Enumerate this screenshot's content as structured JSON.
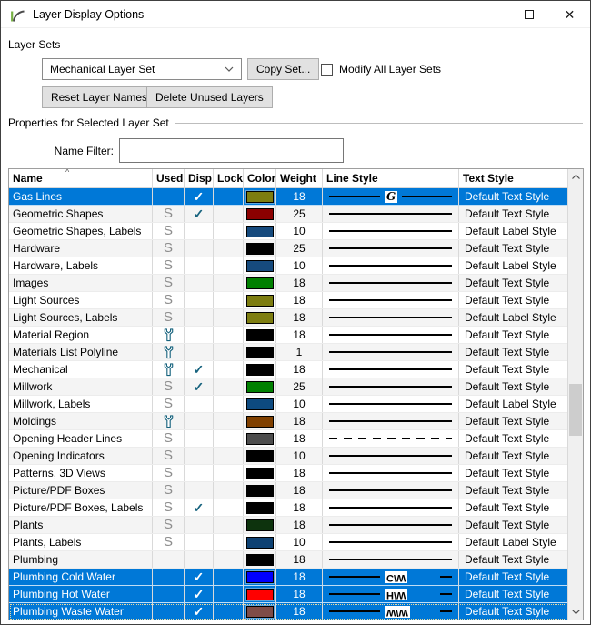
{
  "window": {
    "title": "Layer Display Options"
  },
  "icons": {
    "app_icon": "chief-architect-logo",
    "minimize": "minimize-dash",
    "maximize": "maximize-square",
    "close": "✕",
    "dropdown_chevron": "chevron-down",
    "check": "✓",
    "sort_ascending": "^",
    "used_in_plan": "S",
    "used_wrench": "wrench"
  },
  "layer_sets": {
    "group_label": "Layer Sets",
    "selected_set": "Mechanical Layer Set",
    "copy_button": "Copy Set...",
    "modify_all_label": "Modify All Layer Sets",
    "modify_all_checked": false,
    "reset_button": "Reset Layer Names",
    "delete_button": "Delete Unused Layers"
  },
  "properties": {
    "group_label": "Properties for Selected Layer Set",
    "name_filter_label": "Name Filter:",
    "name_filter_value": ""
  },
  "colors": {
    "selection": "#0078d7",
    "check_mark": "#17637e",
    "wrench_icon": "#17637e",
    "used_marker": "#8d8d8d",
    "row_stripe": "#f4f4f4"
  },
  "table": {
    "columns": [
      "Name",
      "Used",
      "Disp",
      "Lock",
      "Color",
      "Weight",
      "Line Style",
      "Text Style"
    ],
    "rows": [
      {
        "name": "Gas Lines",
        "used": "",
        "disp": true,
        "lock": false,
        "color": "#7d7d10",
        "weight": "18",
        "line": {
          "style": "label-mid",
          "label": "G"
        },
        "text_style": "Default Text Style",
        "selected": true,
        "focused": false
      },
      {
        "name": "Geometric Shapes",
        "used": "s",
        "disp": true,
        "lock": false,
        "color": "#8b0000",
        "weight": "25",
        "line": {
          "style": "solid",
          "label": ""
        },
        "text_style": "Default Text Style",
        "selected": false,
        "focused": false
      },
      {
        "name": "Geometric Shapes, Labels",
        "used": "s",
        "disp": false,
        "lock": false,
        "color": "#164a7d",
        "weight": "10",
        "line": {
          "style": "solid",
          "label": ""
        },
        "text_style": "Default Label Style",
        "selected": false,
        "focused": false
      },
      {
        "name": "Hardware",
        "used": "s",
        "disp": false,
        "lock": false,
        "color": "#000000",
        "weight": "25",
        "line": {
          "style": "solid",
          "label": ""
        },
        "text_style": "Default Text Style",
        "selected": false,
        "focused": false
      },
      {
        "name": "Hardware, Labels",
        "used": "s",
        "disp": false,
        "lock": false,
        "color": "#164a7d",
        "weight": "10",
        "line": {
          "style": "solid",
          "label": ""
        },
        "text_style": "Default Label Style",
        "selected": false,
        "focused": false
      },
      {
        "name": "Images",
        "used": "s",
        "disp": false,
        "lock": false,
        "color": "#008000",
        "weight": "18",
        "line": {
          "style": "solid",
          "label": ""
        },
        "text_style": "Default Text Style",
        "selected": false,
        "focused": false
      },
      {
        "name": "Light Sources",
        "used": "s",
        "disp": false,
        "lock": false,
        "color": "#7d7d10",
        "weight": "18",
        "line": {
          "style": "solid",
          "label": ""
        },
        "text_style": "Default Text Style",
        "selected": false,
        "focused": false
      },
      {
        "name": "Light Sources, Labels",
        "used": "s",
        "disp": false,
        "lock": false,
        "color": "#7d7d10",
        "weight": "18",
        "line": {
          "style": "solid",
          "label": ""
        },
        "text_style": "Default Label Style",
        "selected": false,
        "focused": false
      },
      {
        "name": "Material Region",
        "used": "wrench",
        "disp": false,
        "lock": false,
        "color": "#000000",
        "weight": "18",
        "line": {
          "style": "solid",
          "label": ""
        },
        "text_style": "Default Text Style",
        "selected": false,
        "focused": false
      },
      {
        "name": "Materials List Polyline",
        "used": "wrench",
        "disp": false,
        "lock": false,
        "color": "#000000",
        "weight": "1",
        "line": {
          "style": "solid",
          "label": ""
        },
        "text_style": "Default Text Style",
        "selected": false,
        "focused": false
      },
      {
        "name": "Mechanical",
        "used": "wrench",
        "disp": true,
        "lock": false,
        "color": "#000000",
        "weight": "18",
        "line": {
          "style": "solid",
          "label": ""
        },
        "text_style": "Default Text Style",
        "selected": false,
        "focused": false
      },
      {
        "name": "Millwork",
        "used": "s",
        "disp": true,
        "lock": false,
        "color": "#008000",
        "weight": "25",
        "line": {
          "style": "solid",
          "label": ""
        },
        "text_style": "Default Text Style",
        "selected": false,
        "focused": false
      },
      {
        "name": "Millwork, Labels",
        "used": "s",
        "disp": false,
        "lock": false,
        "color": "#0d4a80",
        "weight": "10",
        "line": {
          "style": "solid",
          "label": ""
        },
        "text_style": "Default Label Style",
        "selected": false,
        "focused": false
      },
      {
        "name": "Moldings",
        "used": "wrench",
        "disp": false,
        "lock": false,
        "color": "#804000",
        "weight": "18",
        "line": {
          "style": "solid",
          "label": ""
        },
        "text_style": "Default Text Style",
        "selected": false,
        "focused": false
      },
      {
        "name": "Opening Header Lines",
        "used": "s",
        "disp": false,
        "lock": false,
        "color": "#4d4d4d",
        "weight": "18",
        "line": {
          "style": "dashed",
          "label": ""
        },
        "text_style": "Default Text Style",
        "selected": false,
        "focused": false
      },
      {
        "name": "Opening Indicators",
        "used": "s",
        "disp": false,
        "lock": false,
        "color": "#000000",
        "weight": "10",
        "line": {
          "style": "solid",
          "label": ""
        },
        "text_style": "Default Text Style",
        "selected": false,
        "focused": false
      },
      {
        "name": "Patterns, 3D Views",
        "used": "s",
        "disp": false,
        "lock": false,
        "color": "#000000",
        "weight": "18",
        "line": {
          "style": "solid",
          "label": ""
        },
        "text_style": "Default Text Style",
        "selected": false,
        "focused": false
      },
      {
        "name": "Picture/PDF Boxes",
        "used": "s",
        "disp": false,
        "lock": false,
        "color": "#000000",
        "weight": "18",
        "line": {
          "style": "solid",
          "label": ""
        },
        "text_style": "Default Text Style",
        "selected": false,
        "focused": false
      },
      {
        "name": "Picture/PDF Boxes, Labels",
        "used": "s",
        "disp": true,
        "lock": false,
        "color": "#000000",
        "weight": "18",
        "line": {
          "style": "solid",
          "label": ""
        },
        "text_style": "Default Text Style",
        "selected": false,
        "focused": false
      },
      {
        "name": "Plants",
        "used": "s",
        "disp": false,
        "lock": false,
        "color": "#0d330d",
        "weight": "18",
        "line": {
          "style": "solid",
          "label": ""
        },
        "text_style": "Default Text Style",
        "selected": false,
        "focused": false
      },
      {
        "name": "Plants, Labels",
        "used": "s",
        "disp": false,
        "lock": false,
        "color": "#0d4173",
        "weight": "10",
        "line": {
          "style": "solid",
          "label": ""
        },
        "text_style": "Default Label Style",
        "selected": false,
        "focused": false
      },
      {
        "name": "Plumbing",
        "used": "",
        "disp": false,
        "lock": false,
        "color": "#000000",
        "weight": "18",
        "line": {
          "style": "solid",
          "label": ""
        },
        "text_style": "Default Text Style",
        "selected": false,
        "focused": false
      },
      {
        "name": "Plumbing Cold Water",
        "used": "",
        "disp": true,
        "lock": false,
        "color": "#0000ff",
        "weight": "18",
        "line": {
          "style": "label-end",
          "label": "C/W"
        },
        "text_style": "Default Text Style",
        "selected": true,
        "focused": false
      },
      {
        "name": "Plumbing Hot Water",
        "used": "",
        "disp": true,
        "lock": false,
        "color": "#ff0000",
        "weight": "18",
        "line": {
          "style": "label-end",
          "label": "H/W"
        },
        "text_style": "Default Text Style",
        "selected": true,
        "focused": false
      },
      {
        "name": "Plumbing Waste Water",
        "used": "",
        "disp": true,
        "lock": false,
        "color": "#7f4c47",
        "weight": "18",
        "line": {
          "style": "label-end",
          "label": "W/W"
        },
        "text_style": "Default Text Style",
        "selected": true,
        "focused": true
      }
    ]
  }
}
